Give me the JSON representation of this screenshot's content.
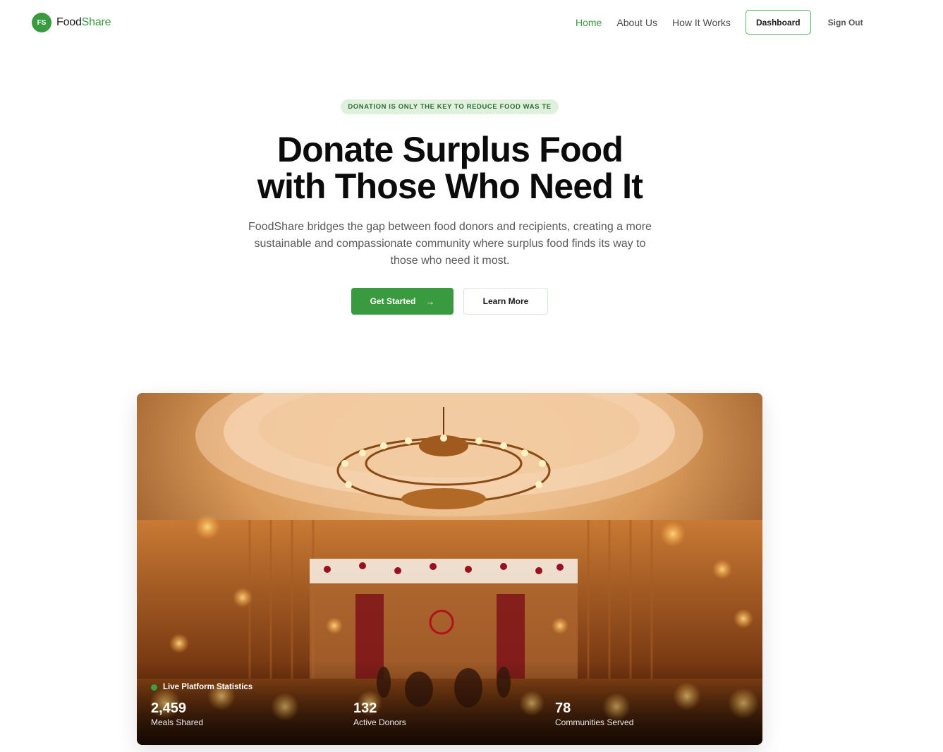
{
  "brand": {
    "badge": "FS",
    "name_part1": "Food",
    "name_part2": "Share"
  },
  "nav": {
    "links": [
      "Home",
      "About Us",
      "How It Works"
    ],
    "dashboard_label": "Dashboard",
    "signout_label": "Sign Out"
  },
  "hero": {
    "pill": "DONATION IS ONLY THE KEY TO REDUCE FOOD WAS TE",
    "title_line1": "Donate Surplus Food",
    "title_line2": "with Those Who Need It",
    "description": "FoodShare bridges the gap between food donors and recipients, creating a more sustainable and compassionate community where surplus food finds its way to those who need it most.",
    "primary_cta": "Get Started",
    "secondary_cta": "Learn More"
  },
  "stats": {
    "live_label": "Live Platform Statistics",
    "items": [
      {
        "value": "2,459",
        "label": "Meals Shared"
      },
      {
        "value": "132",
        "label": "Active Donors"
      },
      {
        "value": "78",
        "label": "Communities Served"
      }
    ]
  },
  "colors": {
    "accent": "#3a9a3f",
    "pill_bg": "#dff1dc"
  },
  "icons": {
    "cta_arrow": "arrow-right-icon"
  }
}
